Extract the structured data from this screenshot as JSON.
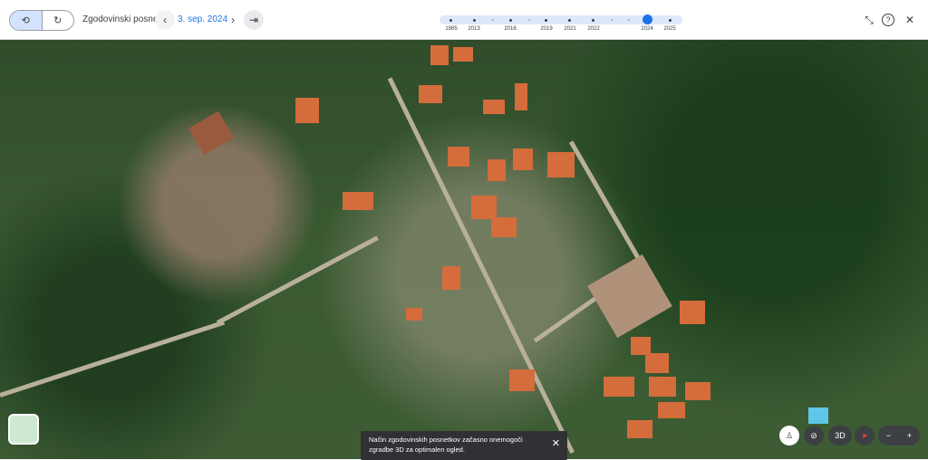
{
  "header": {
    "title": "Zgodovinski posnetki",
    "date": "3. sep. 2024",
    "toggle": {
      "history_icon": "history-icon",
      "clock_icon": "clock-icon"
    }
  },
  "timeline": {
    "years": [
      "1985",
      "2013",
      "2016",
      "2019",
      "2021",
      "2022",
      "2024",
      "2025"
    ],
    "current_year": "2024"
  },
  "toolbar": {
    "collapse_icon": "collapse-icon",
    "help_icon": "help-icon",
    "close_icon": "close-icon"
  },
  "notice": {
    "text": "Način zgodovinskih posnetkov začasno onemogoči zgradbe 3D za optimalen ogled."
  },
  "map_controls": {
    "threed_label": "3D",
    "zoom_out": "−",
    "zoom_in": "+"
  },
  "colors": {
    "accent": "#1a73e8",
    "toggle_active": "#d3e3fd"
  }
}
